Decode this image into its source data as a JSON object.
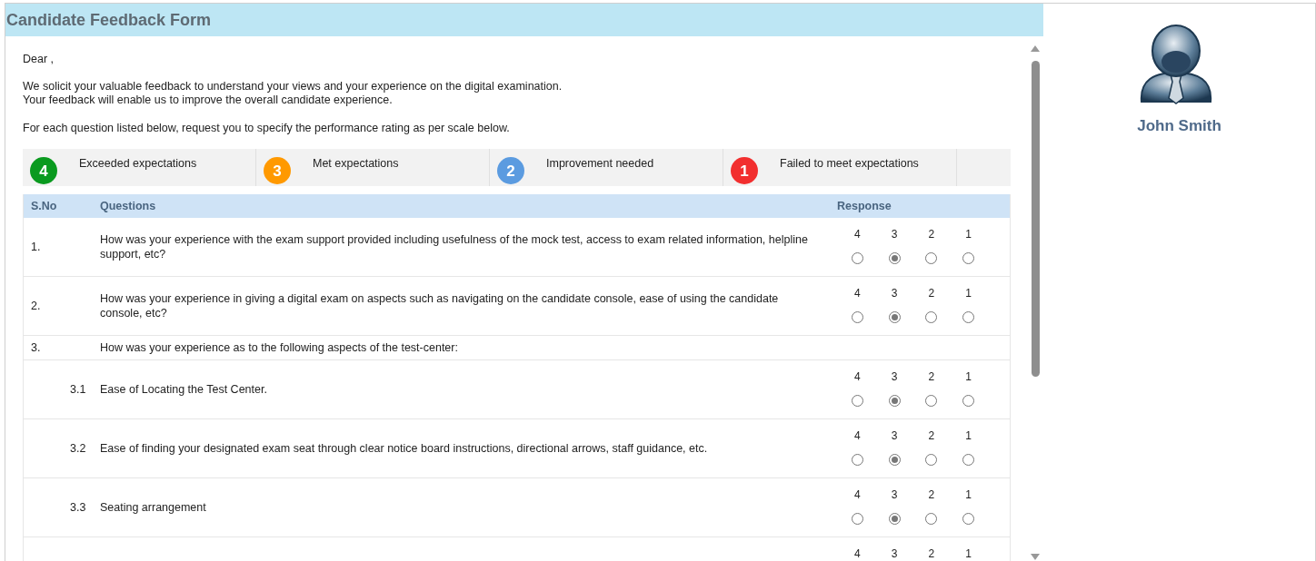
{
  "form": {
    "title": "Candidate Feedback Form"
  },
  "intro": {
    "greeting": "Dear ,",
    "paragraph": [
      "We solicit your valuable feedback to understand your views and your experience on the digital examination.",
      "Your feedback will enable us to improve the overall candidate experience."
    ],
    "instruction": "For each question listed below, request you to specify the performance rating as per scale below."
  },
  "scale": [
    {
      "value": "4",
      "label": "Exceeded expectations",
      "color": "#0a9a1f"
    },
    {
      "value": "3",
      "label": "Met expectations",
      "color": "#ff9900"
    },
    {
      "value": "2",
      "label": "Improvement needed",
      "color": "#5b9be0"
    },
    {
      "value": "1",
      "label": "Failed to meet expectations",
      "color": "#f22f2f"
    }
  ],
  "table": {
    "columns": [
      "S.No",
      "Questions",
      "Response"
    ],
    "rows": [
      {
        "kind": "rated",
        "number": "1.",
        "question": "How was your experience with the exam support provided including usefulness of the mock test, access to exam related information, helpline support, etc?",
        "options": [
          {
            "label": "4",
            "selected": false
          },
          {
            "label": "3",
            "selected": true
          },
          {
            "label": "2",
            "selected": false
          },
          {
            "label": "1",
            "selected": false
          }
        ]
      },
      {
        "kind": "rated",
        "number": "2.",
        "question": "How was your experience in giving a digital exam on aspects such as navigating on the candidate console, ease of using the candidate console, etc?",
        "options": [
          {
            "label": "4",
            "selected": false
          },
          {
            "label": "3",
            "selected": true
          },
          {
            "label": "2",
            "selected": false
          },
          {
            "label": "1",
            "selected": false
          }
        ]
      },
      {
        "kind": "heading",
        "number": "3.",
        "question": "How was your experience as to the following aspects of the test-center:"
      },
      {
        "kind": "sub",
        "number": "3.1",
        "question": "Ease of Locating the Test Center.",
        "options": [
          {
            "label": "4",
            "selected": false
          },
          {
            "label": "3",
            "selected": true
          },
          {
            "label": "2",
            "selected": false
          },
          {
            "label": "1",
            "selected": false
          }
        ]
      },
      {
        "kind": "sub",
        "number": "3.2",
        "question": "Ease of finding your designated exam seat through clear notice board instructions, directional arrows, staff guidance, etc.",
        "options": [
          {
            "label": "4",
            "selected": false
          },
          {
            "label": "3",
            "selected": true
          },
          {
            "label": "2",
            "selected": false
          },
          {
            "label": "1",
            "selected": false
          }
        ]
      },
      {
        "kind": "sub",
        "number": "3.3",
        "question": "Seating arrangement",
        "options": [
          {
            "label": "4",
            "selected": false
          },
          {
            "label": "3",
            "selected": true
          },
          {
            "label": "2",
            "selected": false
          },
          {
            "label": "1",
            "selected": false
          }
        ]
      },
      {
        "kind": "sub",
        "options": [
          {
            "label": "4"
          },
          {
            "label": "3"
          },
          {
            "label": "2"
          },
          {
            "label": "1"
          }
        ]
      }
    ]
  },
  "profile": {
    "name": "John Smith"
  }
}
